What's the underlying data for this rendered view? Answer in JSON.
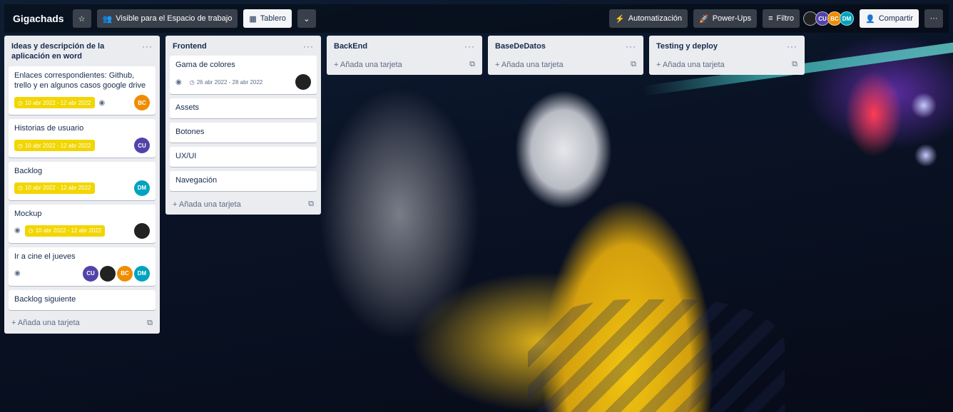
{
  "board": {
    "title": "Gigachads",
    "visibility_label": "Visible para el Espacio de trabajo",
    "view_label": "Tablero",
    "automation_label": "Automatización",
    "powerups_label": "Power-Ups",
    "filter_label": "Filtro",
    "share_label": "Compartir"
  },
  "members": [
    {
      "initials": "",
      "color": "#222222"
    },
    {
      "initials": "CU",
      "color": "#5243aa"
    },
    {
      "initials": "BC",
      "color": "#f08c00"
    },
    {
      "initials": "DM",
      "color": "#00a3bf"
    }
  ],
  "lists": [
    {
      "title": "Ideas y descripción de la aplicación en word",
      "add_label": "Añada una tarjeta",
      "cards": [
        {
          "title": "Enlaces correspondientes: Github, trello y en algunos casos google drive",
          "date": "10 abr 2022 - 12 abr 2022",
          "members": [
            "BC"
          ]
        },
        {
          "title": "Historias de usuario",
          "date": "10 abr 2022 - 12 abr 2022",
          "members": [
            "CU"
          ]
        },
        {
          "title": "Backlog",
          "date": "10 abr 2022 - 12 abr 2022",
          "members": [
            "DM"
          ]
        },
        {
          "title": "Mockup",
          "date": "10 abr 2022 - 12 abr 2022",
          "members": [
            ""
          ]
        },
        {
          "title": "Ir a cine el jueves",
          "members": [
            "CU",
            "",
            "BC",
            "DM"
          ]
        },
        {
          "title": "Backlog siguiente"
        }
      ]
    },
    {
      "title": "Frontend",
      "add_label": "Añada una tarjeta",
      "cards": [
        {
          "title": "Gama de colores",
          "date": "26 abr 2022 - 28 abr 2022",
          "members": [
            ""
          ]
        },
        {
          "title": "Assets"
        },
        {
          "title": "Botones"
        },
        {
          "title": "UX/UI"
        },
        {
          "title": "Navegación"
        }
      ]
    },
    {
      "title": "BackEnd",
      "add_label": "Añada una tarjeta",
      "cards": []
    },
    {
      "title": "BaseDeDatos",
      "add_label": "Añada una tarjeta",
      "cards": []
    },
    {
      "title": "Testing y deploy",
      "add_label": "Añada una tarjeta",
      "cards": []
    }
  ]
}
